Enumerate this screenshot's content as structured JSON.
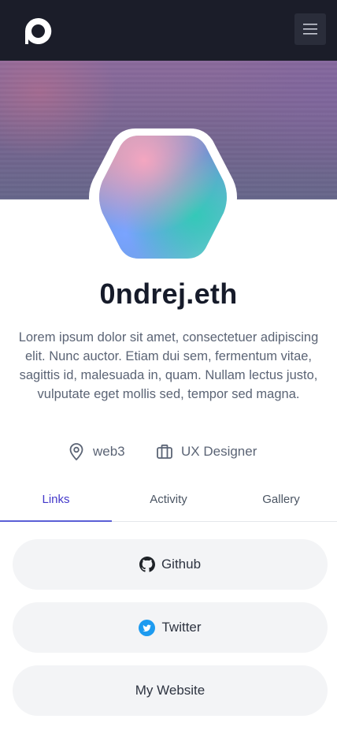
{
  "header": {
    "logo_icon": "logo-icon",
    "menu_icon": "hamburger-menu-icon"
  },
  "profile": {
    "name": "0ndrej.eth",
    "bio": "Lorem ipsum dolor sit amet, consectetuer adipiscing elit. Nunc auctor. Etiam dui sem, fermentum vitae, sagittis id, malesuada in, quam. Nullam lectus justo, vulputate eget mollis sed, tempor sed magna.",
    "location": "web3",
    "job": "UX Designer"
  },
  "tabs": [
    {
      "label": "Links",
      "active": true
    },
    {
      "label": "Activity",
      "active": false
    },
    {
      "label": "Gallery",
      "active": false
    }
  ],
  "links": [
    {
      "label": "Github",
      "icon": "github-icon"
    },
    {
      "label": "Twitter",
      "icon": "twitter-icon"
    },
    {
      "label": "My Website",
      "icon": ""
    }
  ],
  "colors": {
    "header_bg": "#1b1d29",
    "accent": "#4338ca",
    "twitter": "#1d9bf0"
  }
}
